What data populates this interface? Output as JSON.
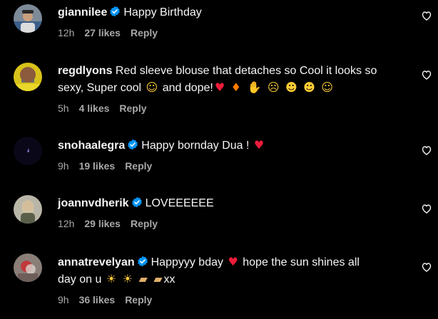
{
  "comments": [
    {
      "username": "giannilee",
      "verified": true,
      "text": "Happy Birthday",
      "time": "12h",
      "likes": "27 likes",
      "reply": "Reply"
    },
    {
      "username": "regdlyons",
      "verified": false,
      "text_line1": "Red sleeve blouse that detaches so Cool it looks so",
      "text_line2": "sexy, Super cool",
      "text_line2b": "and dope!",
      "time": "5h",
      "likes": "4 likes",
      "reply": "Reply"
    },
    {
      "username": "snohaalegra",
      "verified": true,
      "text": "Happy bornday Dua !",
      "time": "9h",
      "likes": "19 likes",
      "reply": "Reply"
    },
    {
      "username": "joannvdherik",
      "verified": true,
      "text": "LOVEEEEEE",
      "time": "12h",
      "likes": "29 likes",
      "reply": "Reply"
    },
    {
      "username": "annatrevelyan",
      "verified": true,
      "text_line1": "Happyyy bday",
      "text_line1b": "hope the sun shines all",
      "text_line2": "day on u",
      "text_line2b": "xx",
      "time": "9h",
      "likes": "36 likes",
      "reply": "Reply"
    }
  ],
  "icons": {
    "verified_badge": "verified-badge-icon",
    "like": "heart-outline-icon"
  },
  "colors": {
    "background": "#000000",
    "text": "#f5f5f5",
    "meta": "#a8a8a8",
    "verified": "#0095f6",
    "heart_emoji": "#ed1c3a"
  }
}
